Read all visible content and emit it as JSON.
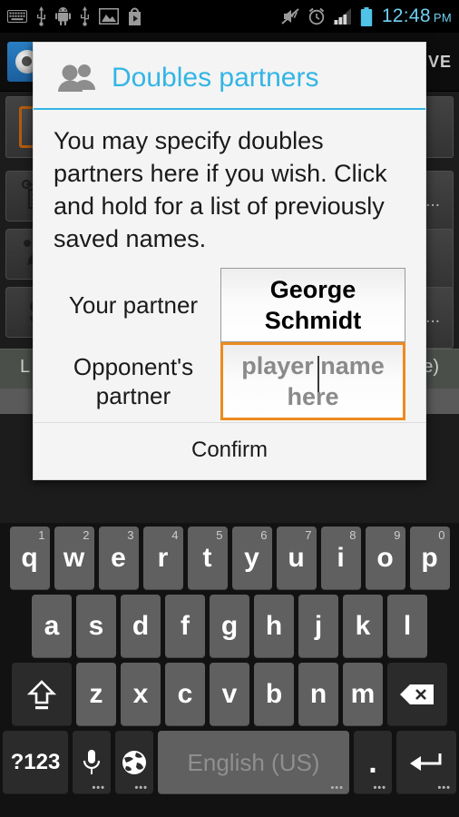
{
  "statusbar": {
    "left_icons": [
      "keyboard-icon",
      "usb-icon",
      "android-icon",
      "usb-icon-2",
      "image-icon",
      "play-store-icon"
    ],
    "right_icons": [
      "mute-icon",
      "alarm-icon",
      "signal-icon",
      "battery-icon"
    ],
    "time": "12:48",
    "ampm": "PM",
    "clock_color": "#6fd0f0"
  },
  "background_app": {
    "actionbar": {
      "app_icon": "app-logo-icon",
      "save_label": "VE"
    },
    "rows": [
      {
        "text": ""
      },
      {
        "text": "a..."
      }
    ],
    "icon_buttons": [
      "scoreboard-icon",
      "edit-pencil-icon",
      "dollar-icon"
    ],
    "strip_left": "L",
    "strip_right": "e)"
  },
  "dialog": {
    "title": "Doubles partners",
    "title_icon": "people-icon",
    "accent_color": "#33b5e5",
    "message": "You may specify doubles partners here if you wish. Click and hold for a list of previously saved names.",
    "fields": [
      {
        "label": "Your partner",
        "value": "George Schmidt",
        "placeholder": "",
        "focused": false
      },
      {
        "label": "Opponent's partner",
        "value": "",
        "placeholder": "player name here",
        "focused": true,
        "focus_color": "#ec8b1f"
      }
    ],
    "confirm_label": "Confirm"
  },
  "keyboard": {
    "row1": [
      {
        "key": "q",
        "hint": "1"
      },
      {
        "key": "w",
        "hint": "2"
      },
      {
        "key": "e",
        "hint": "3"
      },
      {
        "key": "r",
        "hint": "4"
      },
      {
        "key": "t",
        "hint": "5"
      },
      {
        "key": "y",
        "hint": "6"
      },
      {
        "key": "u",
        "hint": "7"
      },
      {
        "key": "i",
        "hint": "8"
      },
      {
        "key": "o",
        "hint": "9"
      },
      {
        "key": "p",
        "hint": "0"
      }
    ],
    "row2": [
      {
        "key": "a"
      },
      {
        "key": "s"
      },
      {
        "key": "d"
      },
      {
        "key": "f"
      },
      {
        "key": "g"
      },
      {
        "key": "h"
      },
      {
        "key": "j"
      },
      {
        "key": "k"
      },
      {
        "key": "l"
      }
    ],
    "row3": [
      {
        "key": "z"
      },
      {
        "key": "x"
      },
      {
        "key": "c"
      },
      {
        "key": "v"
      },
      {
        "key": "b"
      },
      {
        "key": "n"
      },
      {
        "key": "m"
      }
    ],
    "shift_icon": "shift-icon",
    "backspace_icon": "backspace-icon",
    "symbols_label": "?123",
    "mic_icon": "microphone-icon",
    "globe_icon": "globe-icon",
    "space_label": "English (US)",
    "period_label": ".",
    "enter_icon": "enter-icon"
  }
}
